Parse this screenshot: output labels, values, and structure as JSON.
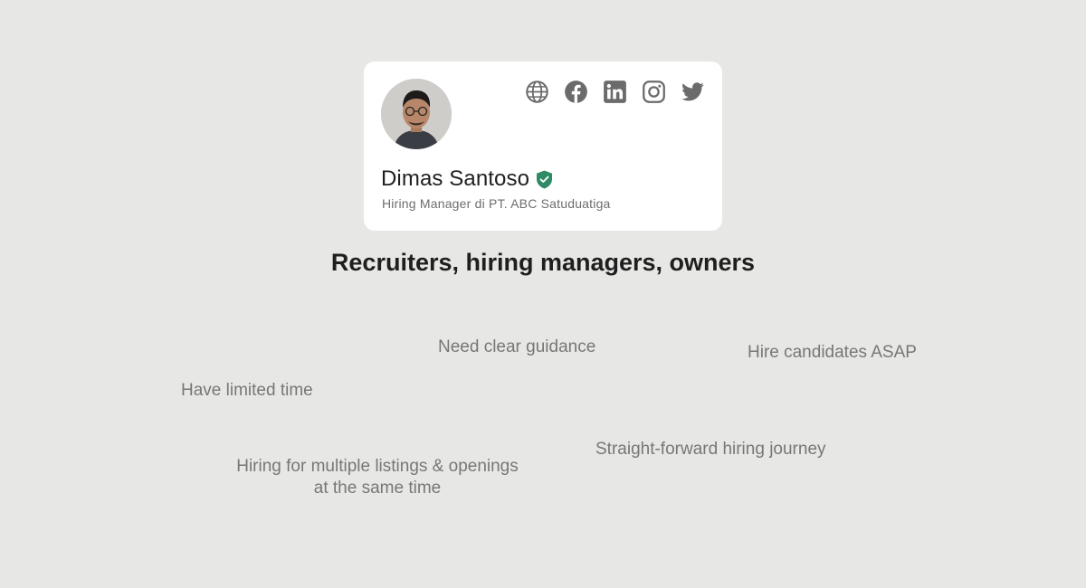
{
  "profile": {
    "name": "Dimas Santoso",
    "role": "Hiring Manager di PT. ABC Satuduatiga",
    "verified": true,
    "avatar": "portrait-photo",
    "socials": [
      {
        "icon": "globe-icon",
        "network": "website"
      },
      {
        "icon": "facebook-icon",
        "network": "facebook"
      },
      {
        "icon": "linkedin-icon",
        "network": "linkedin"
      },
      {
        "icon": "instagram-icon",
        "network": "instagram"
      },
      {
        "icon": "twitter-icon",
        "network": "twitter"
      }
    ]
  },
  "heading": "Recruiters, hiring managers, owners",
  "traits": {
    "need_guidance": "Need clear guidance",
    "hire_asap": "Hire candidates ASAP",
    "limited_time": "Have limited time",
    "straightforward": "Straight-forward hiring journey",
    "multiple_listings": "Hiring for multiple listings & openings\nat the same time"
  },
  "colors": {
    "background": "#e7e7e5",
    "card": "#ffffff",
    "icon": "#6b6b6b",
    "verified": "#2e8b66",
    "heading": "#1f1f1f",
    "trait_text": "#777777"
  }
}
